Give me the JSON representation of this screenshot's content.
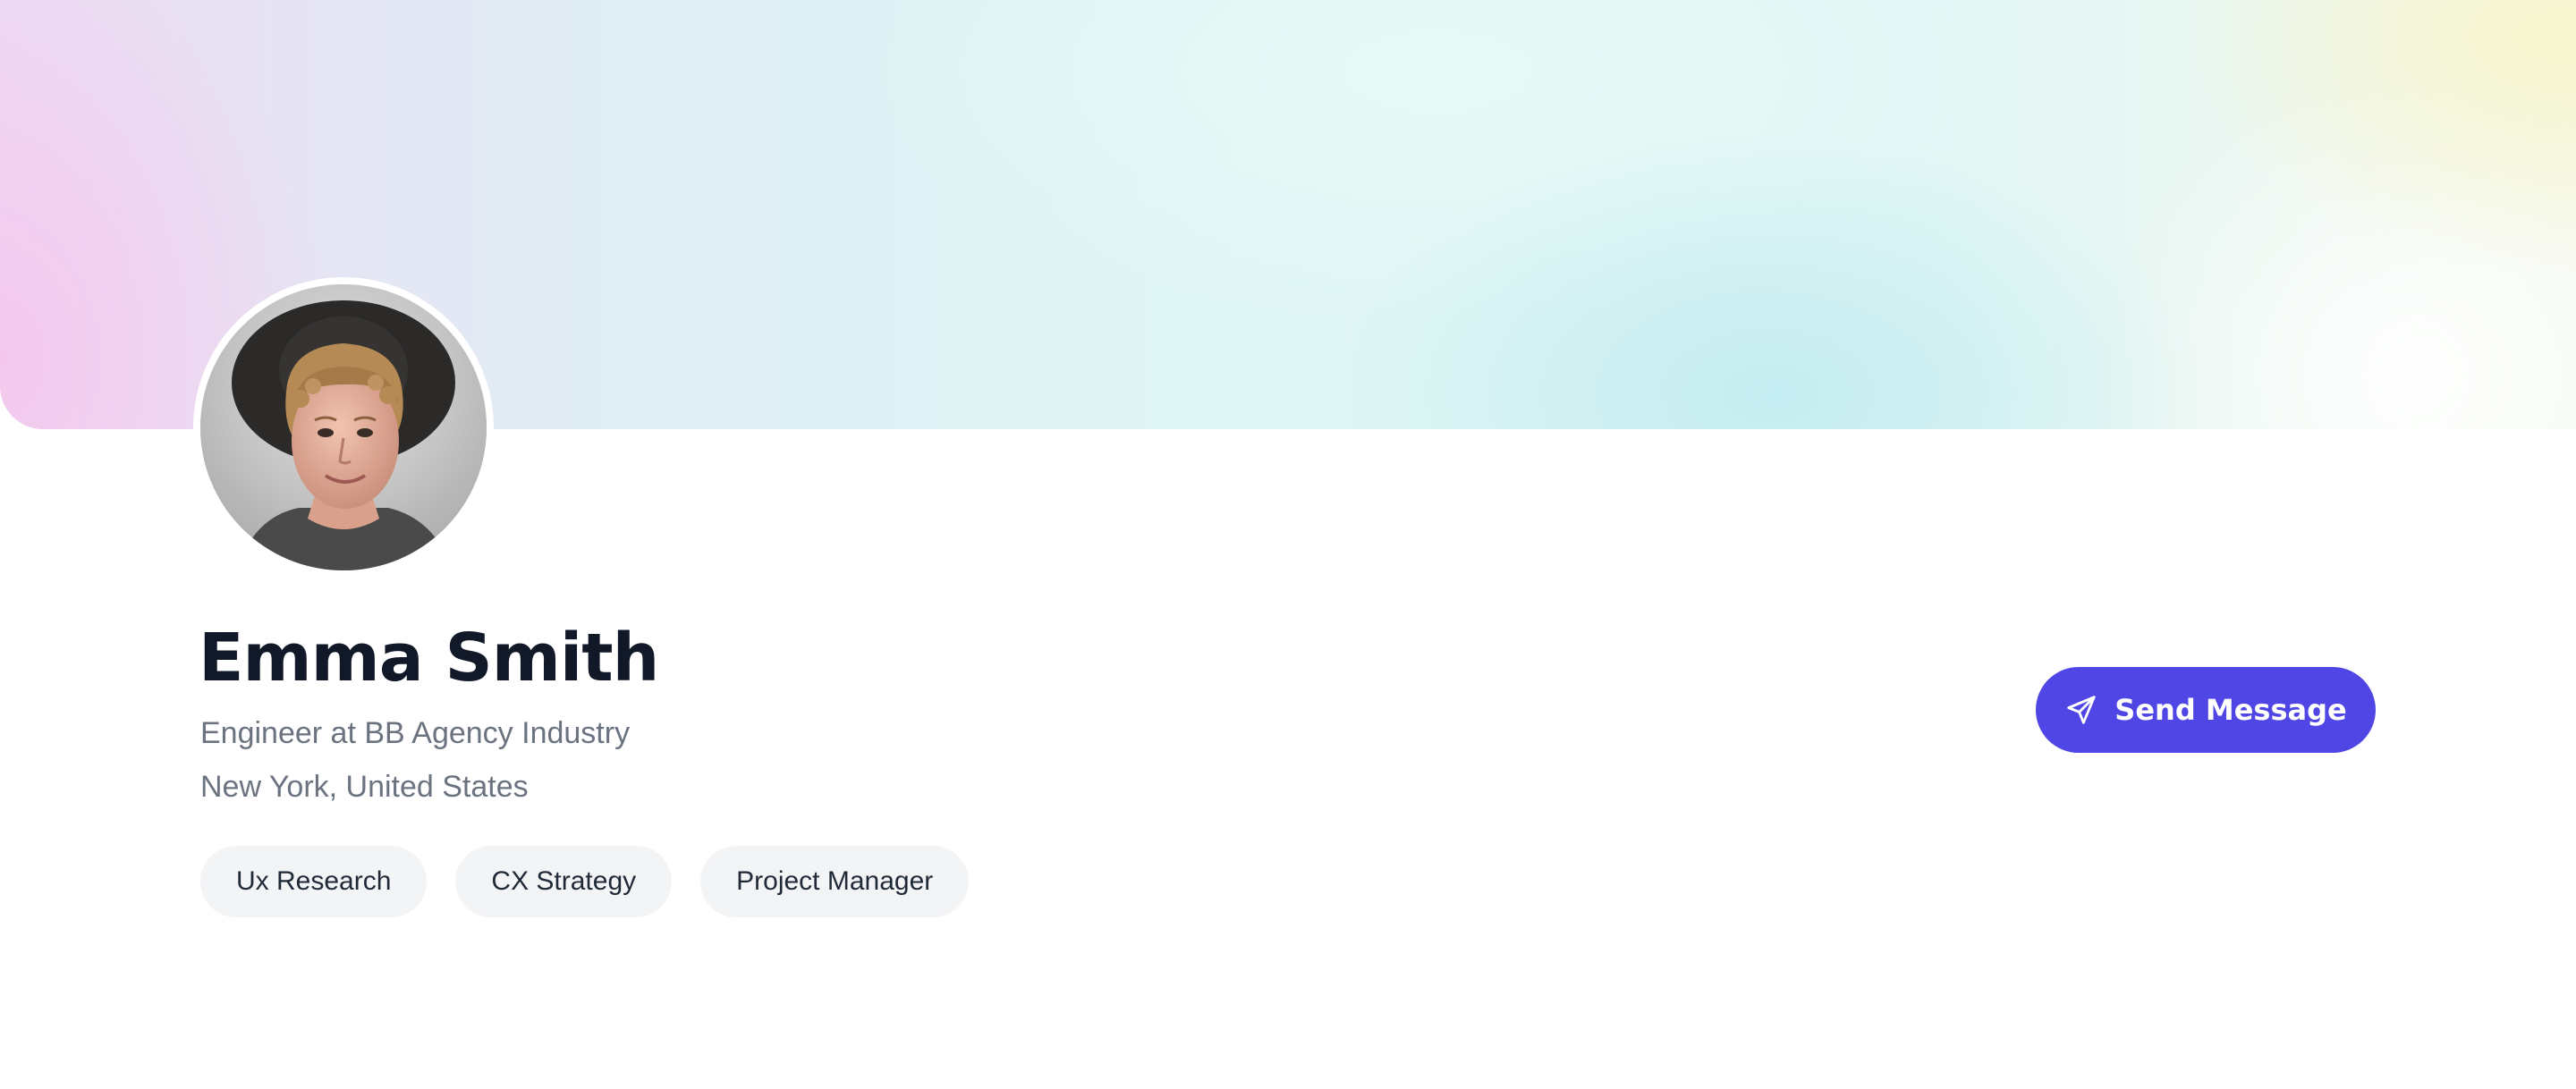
{
  "profile": {
    "name": "Emma Smith",
    "job": "Engineer at BB Agency Industry",
    "location": "New York, United States",
    "tags": [
      "Ux Research",
      "CX Strategy",
      "Project Manager"
    ],
    "avatar": "profile-photo",
    "cover": "gradient-cover"
  },
  "actions": {
    "send_message_label": "Send Message",
    "send_message_icon": "paper-plane-icon"
  },
  "colors": {
    "accent": "#4f46e5",
    "name": "#111827",
    "meta": "#6b7280",
    "tag_bg": "#f3f4f6"
  }
}
